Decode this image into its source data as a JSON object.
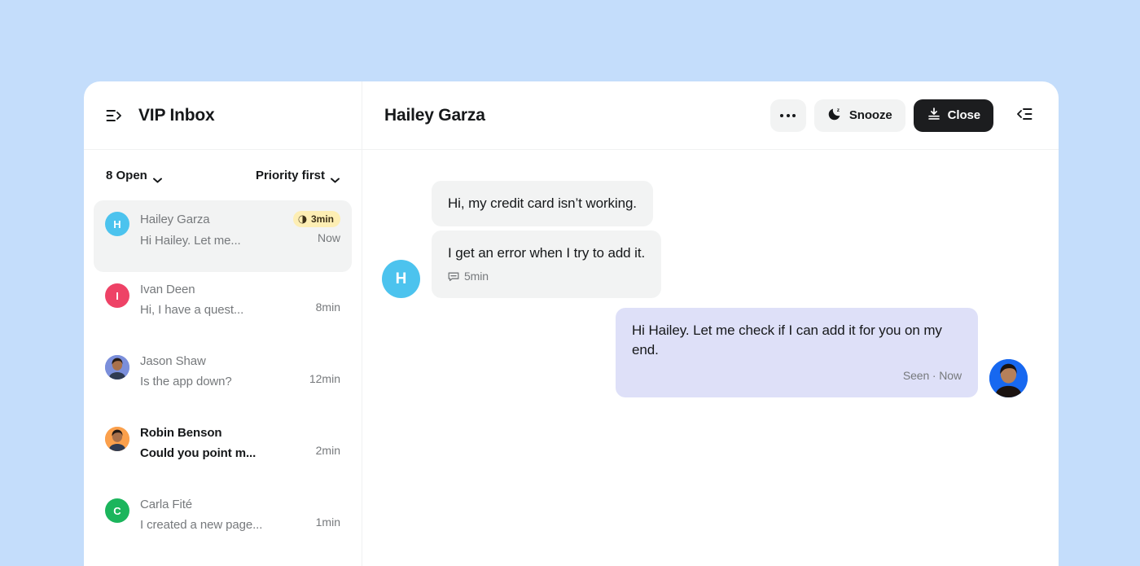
{
  "colors": {
    "page_background": "#c4ddfb",
    "card_background": "#ffffff",
    "selected_row": "#f2f3f3",
    "dark_button": "#1c1d1f",
    "sla_badge": "#fdeeb4",
    "outgoing_bubble": "#dee0f8",
    "incoming_bubble": "#f2f3f3"
  },
  "inbox": {
    "toggle_icon": "panel-expand-icon",
    "title": "VIP Inbox",
    "filters": {
      "status": {
        "label": "8 Open",
        "chevron_icon": "chevron-down-icon"
      },
      "sort": {
        "label": "Priority first",
        "chevron_icon": "chevron-down-icon"
      }
    },
    "conversations": [
      {
        "name": "Hailey Garza",
        "preview": "Hi Hailey. Let me...",
        "time": "Now",
        "badge": "3min",
        "badge_icon": "half-circle-timer-icon",
        "selected": true,
        "unread": false,
        "avatar": {
          "type": "initial",
          "initial": "H",
          "color": "#4cc3ee"
        }
      },
      {
        "name": "Ivan Deen",
        "preview": "Hi, I have a quest...",
        "time": "8min",
        "badge": "",
        "selected": false,
        "unread": false,
        "avatar": {
          "type": "initial",
          "initial": "I",
          "color": "#ee4266"
        }
      },
      {
        "name": "Jason Shaw",
        "preview": "Is the app down?",
        "time": "12min",
        "badge": "",
        "selected": false,
        "unread": false,
        "avatar": {
          "type": "photo",
          "initial": "",
          "color": "#7b8fdb"
        }
      },
      {
        "name": "Robin Benson",
        "preview": "Could you point m...",
        "time": "2min",
        "badge": "",
        "selected": false,
        "unread": true,
        "avatar": {
          "type": "photo",
          "initial": "",
          "color": "#fba04c"
        }
      },
      {
        "name": "Carla Fité",
        "preview": "I created a new page...",
        "time": "1min",
        "badge": "",
        "selected": false,
        "unread": false,
        "avatar": {
          "type": "initial",
          "initial": "C",
          "color": "#1bb55c"
        }
      }
    ]
  },
  "conversation": {
    "title": "Hailey Garza",
    "actions": {
      "more": {
        "label": "",
        "icon": "ellipsis-icon"
      },
      "snooze": {
        "label": "Snooze",
        "icon": "moon-z-icon"
      },
      "close": {
        "label": "Close",
        "icon": "archive-down-icon"
      },
      "collapse": {
        "label": "",
        "icon": "panel-collapse-icon"
      }
    },
    "messages": [
      {
        "direction": "in",
        "text": "Hi, my credit card isn’t working.",
        "meta": "",
        "meta_icon": "",
        "show_avatar": false
      },
      {
        "direction": "in",
        "text": "I get an error when I try to add it.",
        "meta": "5min",
        "meta_icon": "reply-bubble-icon",
        "show_avatar": true,
        "avatar": {
          "type": "initial",
          "initial": "H",
          "color": "#4cc3ee"
        }
      },
      {
        "direction": "out",
        "text": "Hi Hailey. Let me check if I can add it for you on my end.",
        "meta": "Seen · Now",
        "meta_icon": "",
        "show_avatar": true,
        "avatar": {
          "type": "photo",
          "initial": "",
          "color": "#1768f0"
        }
      }
    ]
  }
}
